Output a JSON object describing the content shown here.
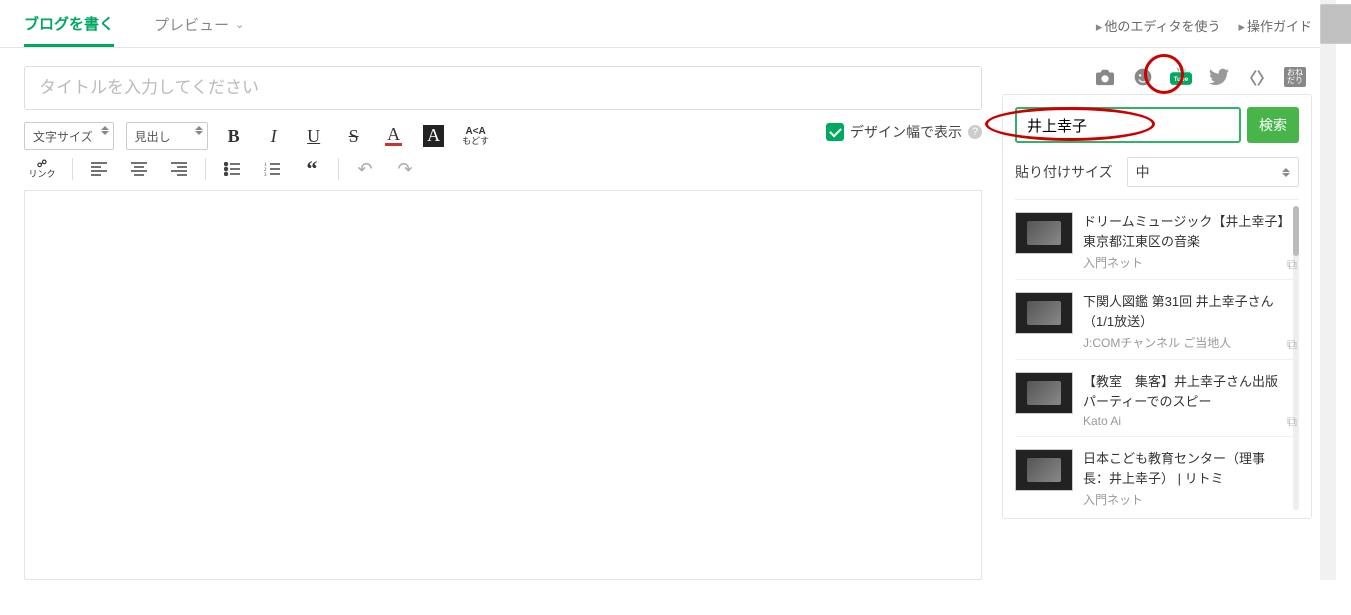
{
  "tabs": {
    "write": "ブログを書く",
    "preview": "プレビュー"
  },
  "toplinks": {
    "other_editor": "他のエディタを使う",
    "guide": "操作ガイド"
  },
  "title_placeholder": "タイトルを入力してください",
  "toolbar": {
    "font_size": "文字サイズ",
    "heading": "見出し",
    "link_label": "リンク",
    "undo_label": "もどす",
    "design_width": "デザイン幅で表示"
  },
  "side": {
    "search_value": "井上幸子",
    "search_btn": "検索",
    "paste_size_label": "貼り付けサイズ",
    "paste_size_value": "中"
  },
  "results": [
    {
      "title": "ドリームミュージック【井上幸子】東京都江東区の音楽",
      "channel": "入門ネット"
    },
    {
      "title": "下関人図鑑 第31回 井上幸子さん（1/1放送）",
      "channel": "J:COMチャンネル ご当地人"
    },
    {
      "title": "【教室　集客】井上幸子さん出版パーティーでのスピー",
      "channel": "Kato Ai"
    },
    {
      "title": "日本こども教育センター（理事長：井上幸子） | リトミ",
      "channel": "入門ネット"
    }
  ]
}
